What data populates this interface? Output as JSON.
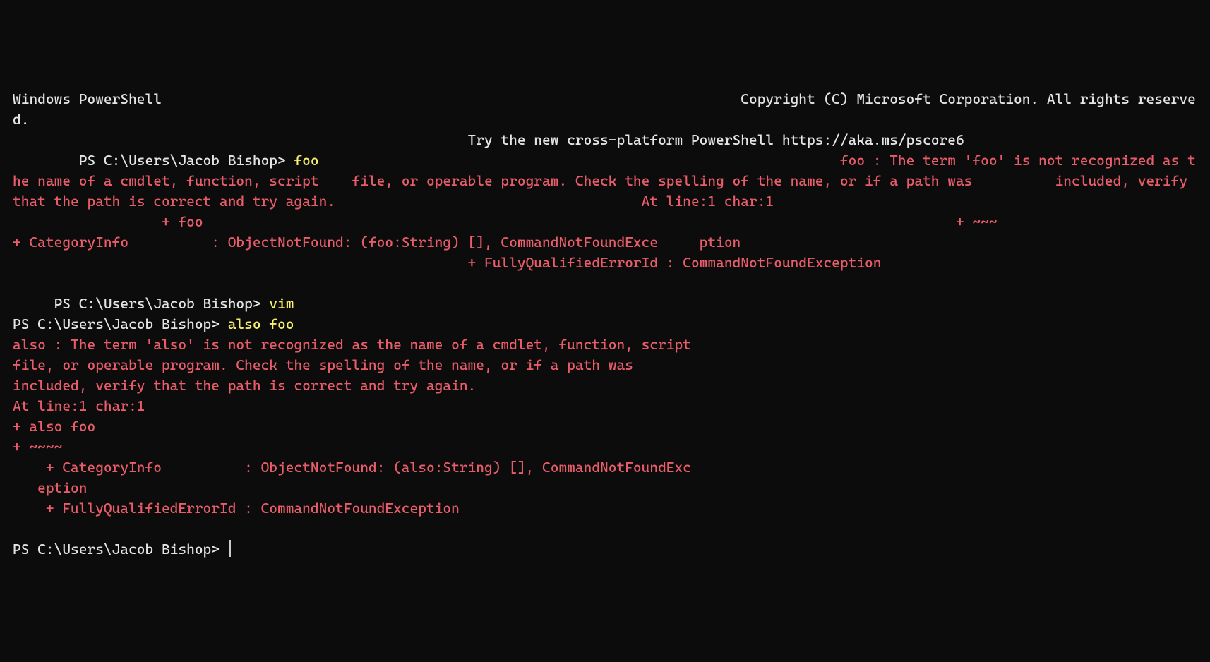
{
  "banner": {
    "line1": "Windows PowerShell                                                                      Copyright (C) Microsoft Corporation. All rights reserved.",
    "line2": "                                                       Try the new cross-platform PowerShell https://aka.ms/pscore6"
  },
  "block1": {
    "prompt_prefix": "        PS C:\\Users\\Jacob Bishop> ",
    "command": "foo",
    "gap": "                                                               ",
    "err_a": "foo : The term 'foo' is not recognized as the name of a cmdlet, function, script    file, or operable program. Check the spelling of the name, or if a path was          included, verify that the path is correct and try again.                                     At line:1 char:1",
    "err_b": "                  + foo                                                                                           + ~~~                                                                                                   + CategoryInfo          : ObjectNotFound: (foo:String) [], CommandNotFoundExce     ption",
    "err_c": "                                                       + FullyQualifiedErrorId : CommandNotFoundException"
  },
  "block2": {
    "prompt_prefix": "     PS C:\\Users\\Jacob Bishop> ",
    "command": "vim"
  },
  "block3": {
    "prompt_prefix": "PS C:\\Users\\Jacob Bishop> ",
    "command": "also foo",
    "err_lines": [
      "also : The term 'also' is not recognized as the name of a cmdlet, function, script",
      "file, or operable program. Check the spelling of the name, or if a path was",
      "included, verify that the path is correct and try again.",
      "At line:1 char:1",
      "+ also foo",
      "+ ~~~~",
      "    + CategoryInfo          : ObjectNotFound: (also:String) [], CommandNotFoundExc",
      "   eption",
      "    + FullyQualifiedErrorId : CommandNotFoundException"
    ]
  },
  "final_prompt": "PS C:\\Users\\Jacob Bishop> "
}
